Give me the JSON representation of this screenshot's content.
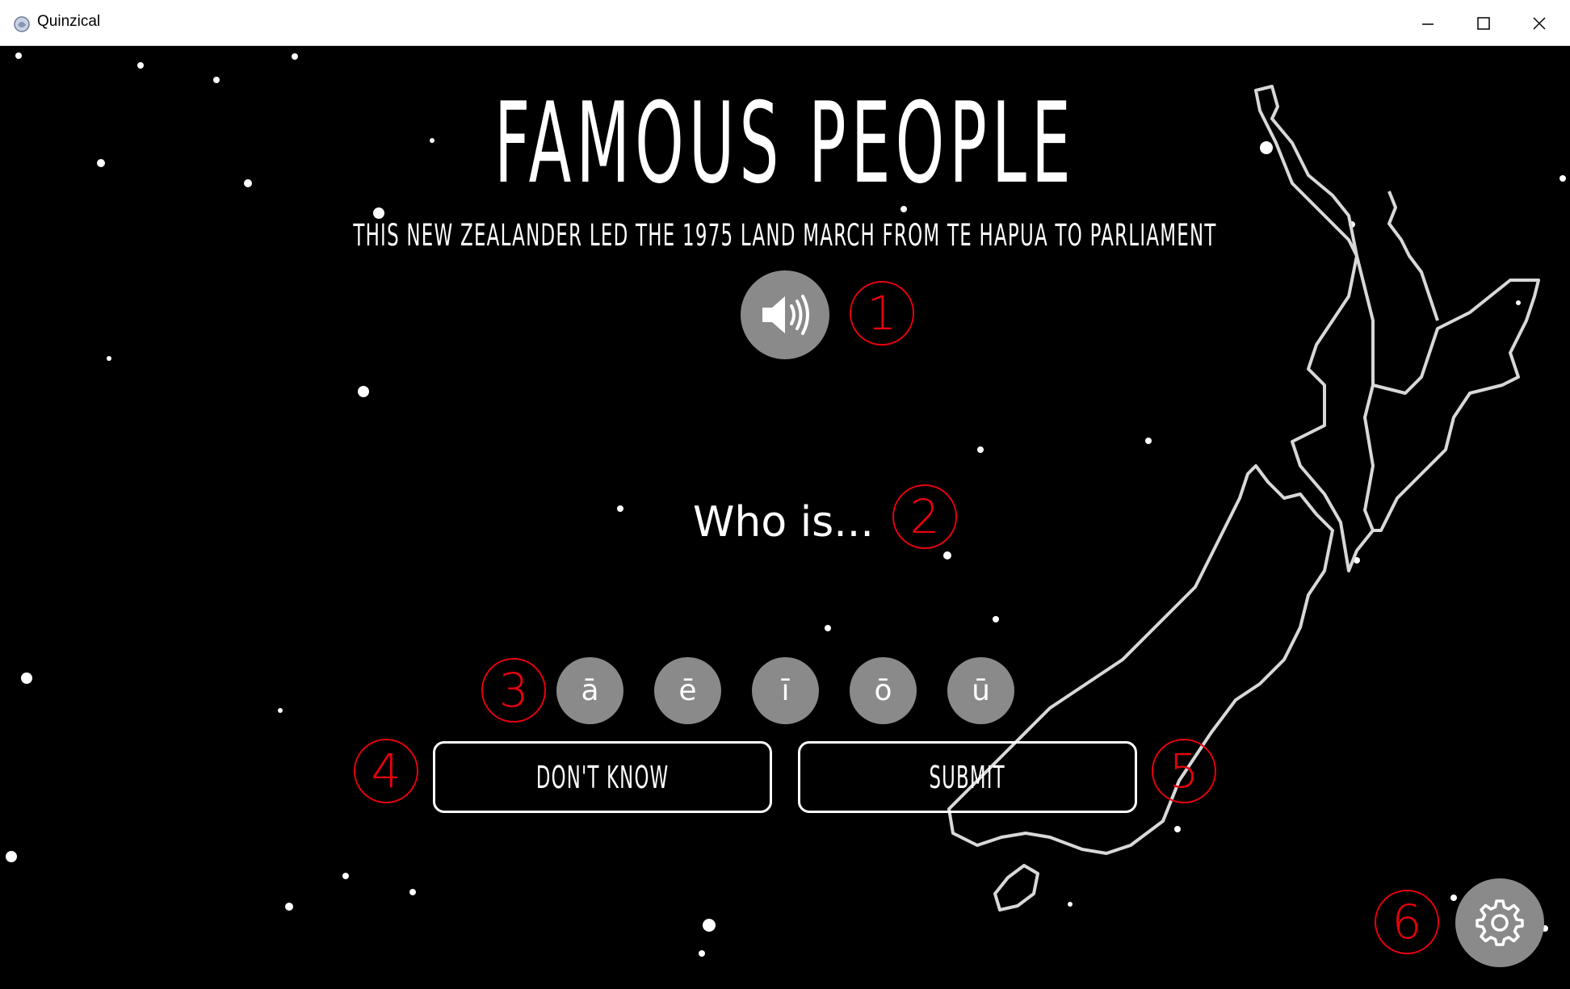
{
  "window": {
    "title": "Quinzical"
  },
  "question": {
    "category": "FAMOUS PEOPLE",
    "clue": "THIS NEW ZEALANDER LED THE 1975 LAND MARCH FROM TE HAPUA TO PARLIAMENT",
    "prompt": "Who is..."
  },
  "macron_keys": [
    "ā",
    "ē",
    "ī",
    "ō",
    "ū"
  ],
  "buttons": {
    "dont_know": "DON'T KNOW",
    "submit": "SUBMIT"
  },
  "annotations": [
    "1",
    "2",
    "3",
    "4",
    "5",
    "6"
  ],
  "icons": {
    "speaker": "speaker-icon",
    "settings": "gear-icon"
  },
  "colors": {
    "background": "#000000",
    "button_grey": "#8a8a8a",
    "annotation_red": "#e8000b",
    "foreground": "#ffffff"
  }
}
